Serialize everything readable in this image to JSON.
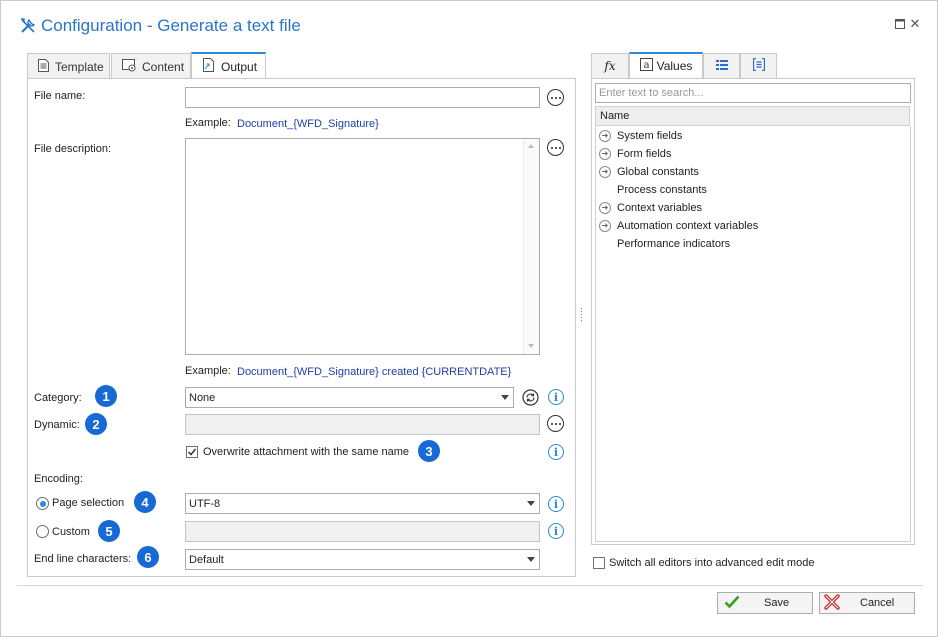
{
  "window": {
    "title": "Configuration - Generate a text file"
  },
  "left_tabs": [
    {
      "label": "Template",
      "icon": "document-icon"
    },
    {
      "label": "Content",
      "icon": "content-settings-icon"
    },
    {
      "label": "Output",
      "icon": "output-file-icon",
      "active": true
    }
  ],
  "form": {
    "file_name_label": "File name:",
    "file_name_value": "",
    "file_name_example_label": "Example:",
    "file_name_example": "Document_{WFD_Signature}",
    "file_description_label": "File description:",
    "file_description_value": "",
    "file_description_example_label": "Example:",
    "file_description_example": "Document_{WFD_Signature} created {CURRENTDATE}",
    "category_label": "Category:",
    "category_value": "None",
    "dynamic_label": "Dynamic:",
    "dynamic_value": "",
    "overwrite_label": "Overwrite attachment with the same name",
    "overwrite_checked": true,
    "encoding_label": "Encoding:",
    "page_selection_label": "Page selection",
    "page_selection_checked": true,
    "page_selection_value": "UTF-8",
    "custom_label": "Custom",
    "custom_checked": false,
    "custom_value": "",
    "end_line_label": "End line characters:",
    "end_line_value": "Default"
  },
  "badges": [
    "1",
    "2",
    "3",
    "4",
    "5",
    "6"
  ],
  "right_tabs": [
    {
      "label": "",
      "icon": "fx-icon"
    },
    {
      "label": "Values",
      "icon": "values-icon",
      "active": true
    },
    {
      "label": "",
      "icon": "list-icon"
    },
    {
      "label": "",
      "icon": "brackets-icon"
    }
  ],
  "values_panel": {
    "search_placeholder": "Enter text to search...",
    "column_header": "Name",
    "items": [
      {
        "label": "System fields",
        "expandable": true
      },
      {
        "label": "Form fields",
        "expandable": true
      },
      {
        "label": "Global constants",
        "expandable": true
      },
      {
        "label": "Process constants",
        "expandable": false
      },
      {
        "label": "Context variables",
        "expandable": true
      },
      {
        "label": "Automation context variables",
        "expandable": true
      },
      {
        "label": "Performance indicators",
        "expandable": false
      }
    ],
    "advanced_mode_label": "Switch all editors into advanced edit mode",
    "advanced_mode_checked": false
  },
  "footer": {
    "save_label": "Save",
    "cancel_label": "Cancel"
  },
  "colors": {
    "accent": "#2a8ad8",
    "title": "#2a76c6",
    "badge": "#1769d6",
    "example_text": "#1f3fa8",
    "save_icon": "#3a9d23",
    "cancel_icon": "#d42020"
  }
}
